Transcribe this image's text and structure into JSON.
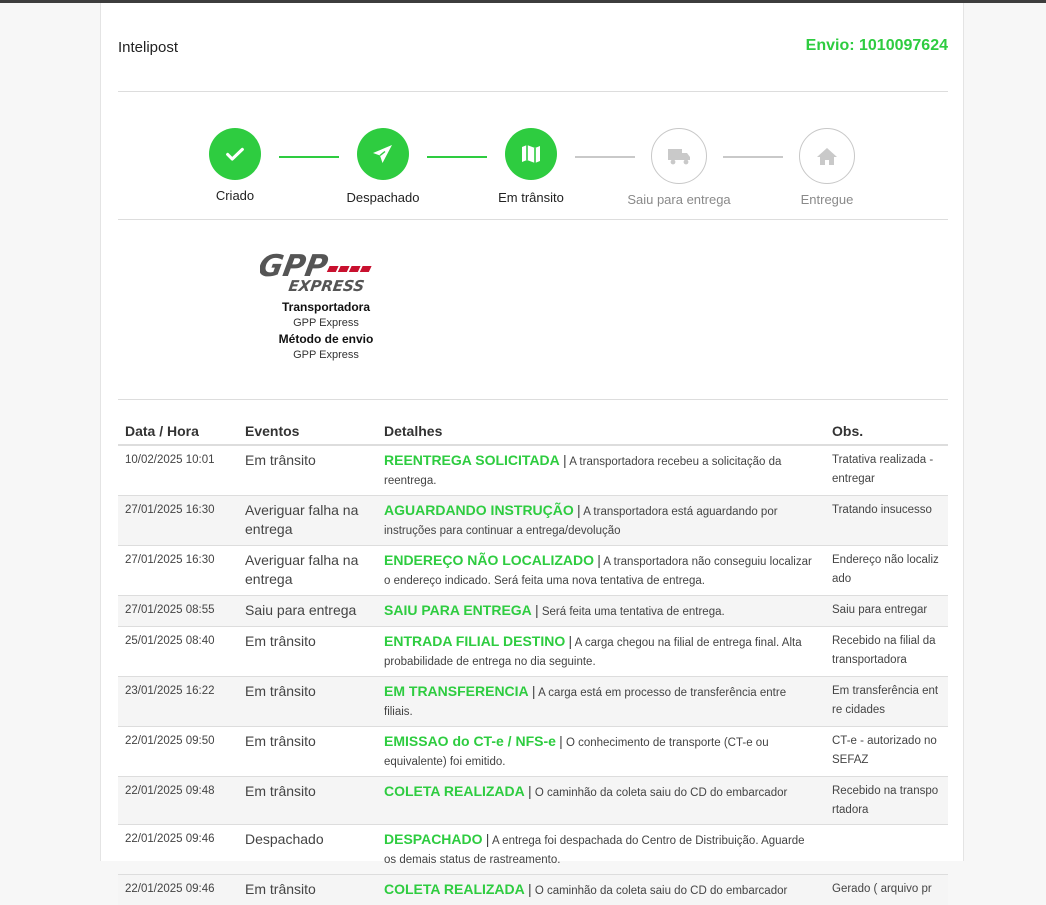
{
  "header": {
    "brand": "Intelipost",
    "shipment": "Envio: 1010097624"
  },
  "steps": [
    {
      "label": "Criado",
      "state": "done",
      "icon": "check-icon"
    },
    {
      "label": "Despachado",
      "state": "done",
      "icon": "paper-plane-icon"
    },
    {
      "label": "Em trânsito",
      "state": "done",
      "icon": "map-icon"
    },
    {
      "label": "Saiu para entrega",
      "state": "todo",
      "icon": "truck-icon"
    },
    {
      "label": "Entregue",
      "state": "todo",
      "icon": "home-icon"
    }
  ],
  "carrier": {
    "logo_text": "GPP EXPRESS",
    "carrier_heading": "Transportadora",
    "carrier_name": "GPP Express",
    "method_heading": "Método de envio",
    "method_name": "GPP Express"
  },
  "table": {
    "headers": [
      "Data / Hora",
      "Eventos",
      "Detalhes",
      "Obs."
    ],
    "rows": [
      {
        "datetime": "10/02/2025 10:01",
        "event": "Em trânsito",
        "code": "REENTREGA SOLICITADA",
        "sep": "|",
        "detail": "A transportadora recebeu a solicitação da reentrega.",
        "obs": "Tratativa realizada - entregar"
      },
      {
        "datetime": "27/01/2025 16:30",
        "event": "Averiguar falha na entrega",
        "code": "AGUARDANDO INSTRUÇÃO",
        "sep": "|",
        "detail": "A transportadora está aguardando por instruções para continuar a entrega/devolução",
        "obs": "Tratando insucesso"
      },
      {
        "datetime": "27/01/2025 16:30",
        "event": "Averiguar falha na entrega",
        "code": "ENDEREÇO NÃO LOCALIZADO",
        "sep": "|",
        "detail": "A transportadora não conseguiu localizar o endereço indicado. Será feita uma nova tentativa de entrega.",
        "obs": "Endereço não localizado"
      },
      {
        "datetime": "27/01/2025 08:55",
        "event": "Saiu para entrega",
        "code": "SAIU PARA ENTREGA",
        "sep": "|",
        "detail": "Será feita uma tentativa de entrega.",
        "obs": "Saiu para entregar"
      },
      {
        "datetime": "25/01/2025 08:40",
        "event": "Em trânsito",
        "code": "ENTRADA FILIAL DESTINO",
        "sep": "|",
        "detail": "A carga chegou na filial de entrega final. Alta probabilidade de entrega no dia seguinte.",
        "obs": "Recebido na filial da transportadora"
      },
      {
        "datetime": "23/01/2025 16:22",
        "event": "Em trânsito",
        "code": "EM TRANSFERENCIA",
        "sep": "|",
        "detail": "A carga está em processo de transferência entre filiais.",
        "obs": "Em transferência entre cidades"
      },
      {
        "datetime": "22/01/2025 09:50",
        "event": "Em trânsito",
        "code": "EMISSAO do CT-e / NFS-e",
        "sep": "|",
        "detail": "O conhecimento de transporte (CT-e ou equivalente) foi emitido.",
        "obs": "CT-e - autorizado no SEFAZ"
      },
      {
        "datetime": "22/01/2025 09:48",
        "event": "Em trânsito",
        "code": "COLETA REALIZADA",
        "sep": "|",
        "detail": "O caminhão da coleta saiu do CD do embarcador",
        "obs": "Recebido na transportadora"
      },
      {
        "datetime": "22/01/2025 09:46",
        "event": "Despachado",
        "code": "DESPACHADO",
        "sep": "|",
        "detail": "A entrega foi despachada do Centro de Distribuição. Aguarde os demais status de rastreamento.",
        "obs": ""
      },
      {
        "datetime": "22/01/2025 09:46",
        "event": "Em trânsito",
        "code": "COLETA REALIZADA",
        "sep": "|",
        "detail": "O caminhão da coleta saiu do CD do embarcador",
        "obs": "Gerado ( arquivo pr"
      }
    ]
  },
  "colors": {
    "accent": "#2ecc40",
    "inactive": "#c8c8c8",
    "logo_red": "#c8102e"
  }
}
